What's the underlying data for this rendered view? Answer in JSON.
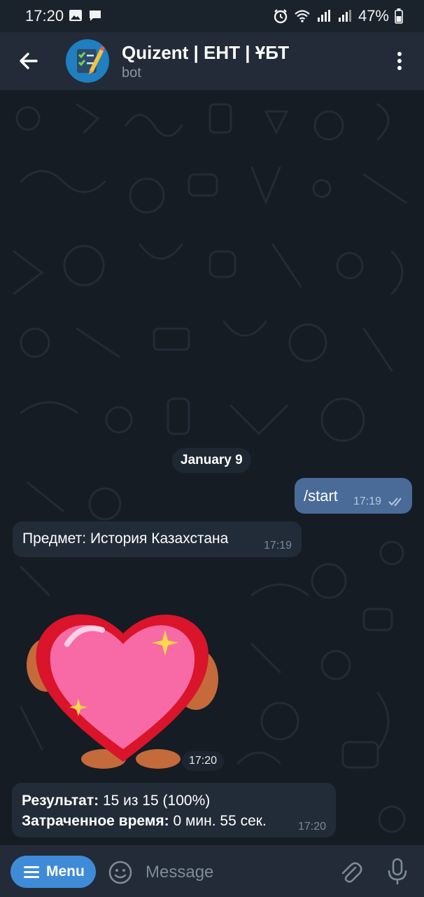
{
  "status_bar": {
    "time": "17:20",
    "battery": "47%"
  },
  "header": {
    "title": "Quizent | ЕНТ | ҰБТ",
    "subtitle": "bot"
  },
  "chat": {
    "date_separator": "January 9",
    "messages": [
      {
        "direction": "outgoing",
        "text": "/start",
        "time": "17:19",
        "status": "read"
      },
      {
        "direction": "incoming",
        "text": "Предмет: История Казахстана",
        "time": "17:19"
      },
      {
        "direction": "incoming",
        "type": "sticker",
        "sticker": "heart-sticker",
        "time": "17:20"
      },
      {
        "direction": "incoming",
        "line1_label": "Результат:",
        "line1_value": " 15 из 15 (100%)",
        "line2_label": "Затраченное время:",
        "line2_value": " 0 мин. 55 сек.",
        "time": "17:20"
      }
    ]
  },
  "input_bar": {
    "menu_label": "Menu",
    "placeholder": "Message"
  },
  "colors": {
    "chat_background": "#151c24",
    "header_background": "#222b37",
    "outgoing_bubble": "#4a6a98",
    "incoming_bubble": "#222c38",
    "menu_button": "#3f8bd8"
  },
  "icons": [
    "back-arrow-icon",
    "bot-avatar-icon",
    "more-vertical-icon",
    "double-check-icon",
    "emoji-icon",
    "attach-icon",
    "mic-icon",
    "menu-lines-icon"
  ]
}
